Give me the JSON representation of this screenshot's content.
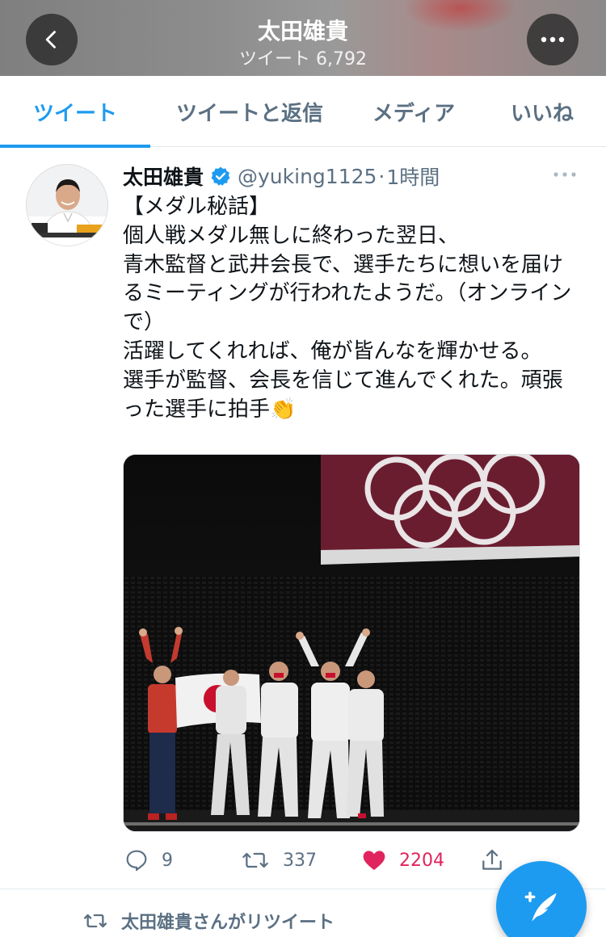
{
  "header": {
    "title": "太田雄貴",
    "subtitle": "ツイート 6,792",
    "back_icon": "chevron-left-icon",
    "more_icon": "ellipsis-icon"
  },
  "tabs": [
    {
      "label": "ツイート",
      "active": true
    },
    {
      "label": "ツイートと返信",
      "active": false
    },
    {
      "label": "メディア",
      "active": false
    },
    {
      "label": "いいね",
      "active": false
    }
  ],
  "tweet": {
    "author_name": "太田雄貴",
    "verified": true,
    "handle": "@yuking1125",
    "separator": "·",
    "time": "1時間",
    "text": "【メダル秘話】\n個人戦メダル無しに終わった翌日、\n青木監督と武井会長で、選手たちに想いを届けるミーティングが行われたようだ。（オンラインで）\n活躍してくれれば、俺が皆んなを輝かせる。\n選手が監督、会長を信じて進んでくれた。頑張った選手に拍手👏",
    "media": {
      "description_icon": "photo",
      "scene": "fencing-team-podium"
    },
    "actions": {
      "reply_count": "9",
      "retweet_count": "337",
      "like_count": "2204",
      "liked": true
    }
  },
  "retweet_context": {
    "label": "太田雄貴さんがリツイート"
  },
  "fab": {
    "icon": "compose-tweet-icon"
  },
  "colors": {
    "accent": "#1d9bf0",
    "like": "#e0245e",
    "secondary_text": "#5b7083"
  }
}
